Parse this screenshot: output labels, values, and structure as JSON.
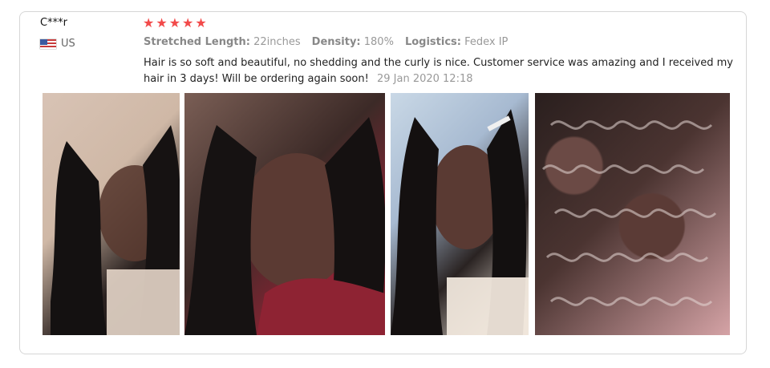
{
  "review": {
    "user": "C***r",
    "country": "US",
    "rating": 5,
    "stars_color": "#f24a4a",
    "meta": [
      {
        "label": "Stretched Length:",
        "value": "22inches"
      },
      {
        "label": "Density:",
        "value": "180%"
      },
      {
        "label": "Logistics:",
        "value": "Fedex IP"
      }
    ],
    "text": "Hair is so soft and beautiful, no shedding and the curly is nice. Customer service was amazing and I received my hair in 3 days! Will be ordering again soon!",
    "date": "29 Jan 2020 12:18"
  },
  "photos": [
    {
      "icon": "review-photo-1"
    },
    {
      "icon": "review-photo-2"
    },
    {
      "icon": "review-photo-3"
    },
    {
      "icon": "review-photo-4"
    }
  ]
}
